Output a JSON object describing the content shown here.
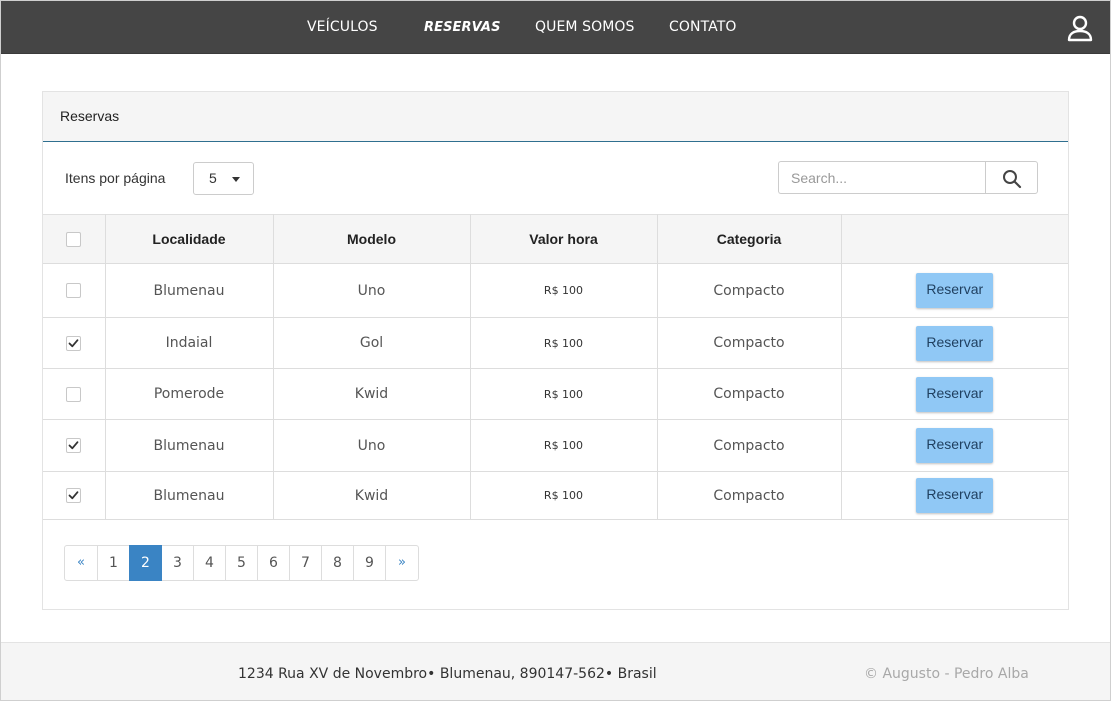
{
  "nav": {
    "items": [
      {
        "label": "VEÍCULOS",
        "active": false
      },
      {
        "label": "RESERVAS",
        "active": true
      },
      {
        "label": "QUEM SOMOS",
        "active": false
      },
      {
        "label": "CONTATO",
        "active": false
      }
    ],
    "user_icon": "user-icon"
  },
  "panel": {
    "title": "Reservas",
    "items_per_page_label": "Itens por página",
    "items_per_page_value": "5",
    "search_placeholder": "Search...",
    "search_icon": "search-icon"
  },
  "table": {
    "headers": [
      "Localidade",
      "Modelo",
      "Valor hora",
      "Categoria",
      ""
    ],
    "rows": [
      {
        "checked": false,
        "localidade": "Blumenau",
        "modelo": "Uno",
        "valor": "R$ 100",
        "categoria": "Compacto",
        "action": "Reservar"
      },
      {
        "checked": true,
        "localidade": "Indaial",
        "modelo": "Gol",
        "valor": "R$ 100",
        "categoria": "Compacto",
        "action": "Reservar"
      },
      {
        "checked": false,
        "localidade": "Pomerode",
        "modelo": "Kwid",
        "valor": "R$ 100",
        "categoria": "Compacto",
        "action": "Reservar"
      },
      {
        "checked": true,
        "localidade": "Blumenau",
        "modelo": "Uno",
        "valor": "R$ 100",
        "categoria": "Compacto",
        "action": "Reservar"
      },
      {
        "checked": true,
        "localidade": "Blumenau",
        "modelo": "Kwid",
        "valor": "R$ 100",
        "categoria": "Compacto",
        "action": "Reservar"
      }
    ]
  },
  "pagination": {
    "prev": "«",
    "next": "»",
    "pages": [
      "1",
      "2",
      "3",
      "4",
      "5",
      "6",
      "7",
      "8",
      "9"
    ],
    "current": "2"
  },
  "footer": {
    "address": "1234 Rua XV de Novembro• Blumenau, 890147-562• Brasil",
    "copyright": "© Augusto - Pedro Alba"
  },
  "colors": {
    "navbar": "#454545",
    "accent": "#3a84c4",
    "reserve_button": "#90c8f5"
  }
}
